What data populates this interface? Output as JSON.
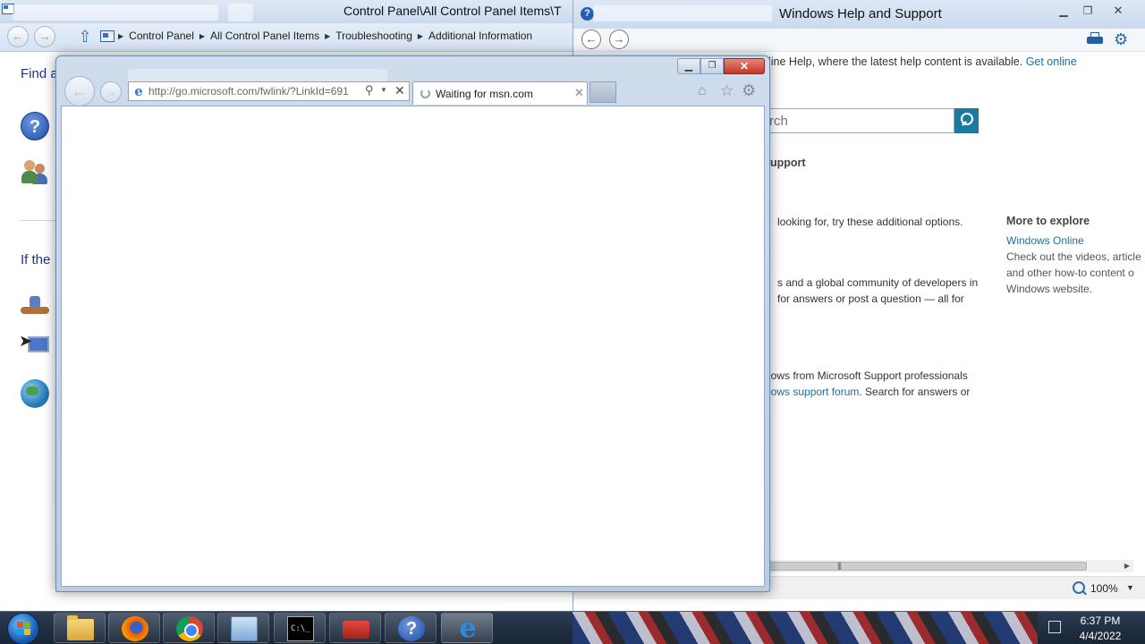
{
  "control_panel": {
    "title": "Control Panel\\All Control Panel Items\\T",
    "breadcrumb": [
      "Control Panel",
      "All Control Panel Items",
      "Troubleshooting",
      "Additional Information"
    ],
    "find_text": "Find a",
    "if_text": "If the"
  },
  "help": {
    "title": "Windows Help and Support",
    "online_msg": "line Help, where the latest help content is available.",
    "get_online": "Get online",
    "search_placeholder": "rch",
    "support_heading": "upport",
    "options_text": "looking for, try these additional options.",
    "community_l1": "s and a global community of developers in",
    "community_l2": "for answers or post a question — all for",
    "pro_l1": "lows from Microsoft Support professionals",
    "pro_link": "lows support forum",
    "pro_rest": ". Search for answers or",
    "more_explore": "More to explore",
    "windows_online": "Windows Online",
    "explore_l1": "Check out the videos, article",
    "explore_l2": "and other how-to content o",
    "explore_l3": "Windows website.",
    "zoom": "100%"
  },
  "ie": {
    "url": "http://go.microsoft.com/fwlink/?LinkId=691",
    "tab_title": "Waiting for msn.com"
  },
  "taskbar": {
    "time": "6:37 PM",
    "date": "4/4/2022"
  }
}
